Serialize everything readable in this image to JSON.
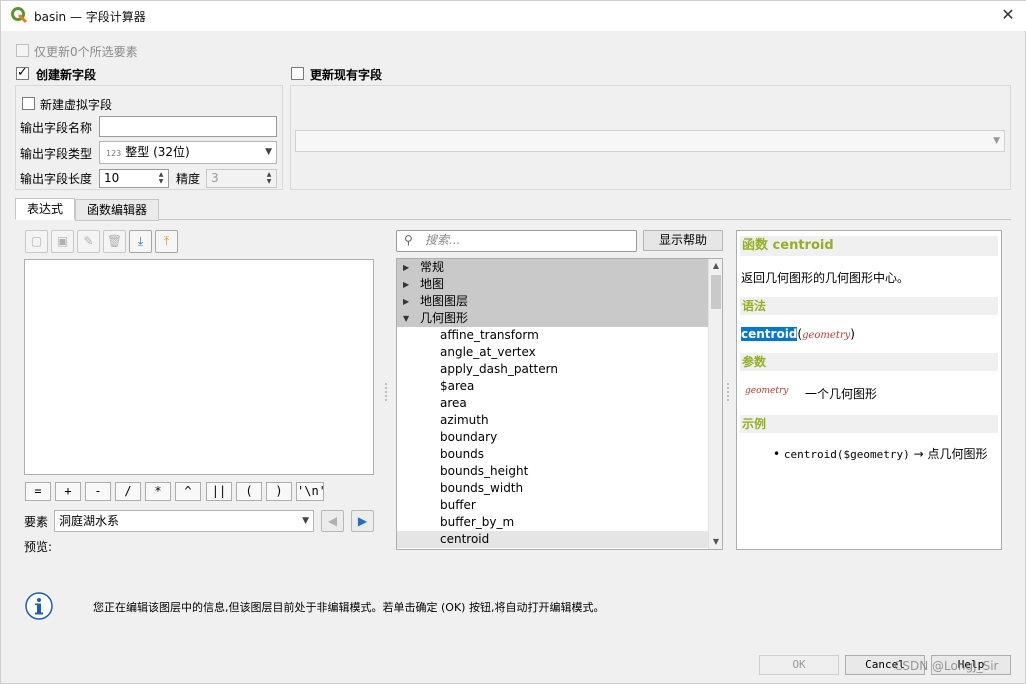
{
  "window": {
    "title": "basin — 字段计算器",
    "close_glyph": "✕",
    "app_icon": "qgis-logo-icon"
  },
  "options": {
    "only_selected_label": "仅更新0个所选要素",
    "create_new_field_label": "创建新字段",
    "create_new_field_checked": true,
    "update_existing_label": "更新现有字段",
    "update_existing_checked": false,
    "virtual_field_label": "新建虚拟字段",
    "virtual_field_checked": false
  },
  "new_field": {
    "name_label": "输出字段名称",
    "name_value": "",
    "type_label": "输出字段类型",
    "type_icon_text": "123",
    "type_value": "整型 (32位)",
    "length_label": "输出字段长度",
    "length_value": "10",
    "precision_label": "精度",
    "precision_value": "3"
  },
  "existing_field": {
    "selected_value": ""
  },
  "tabs": [
    {
      "label": "表达式",
      "active": true
    },
    {
      "label": "函数编辑器",
      "active": false
    }
  ],
  "toolbar": {
    "icons": [
      "new-file-icon",
      "save-icon",
      "edit-icon",
      "delete-icon",
      "import-icon",
      "export-icon"
    ]
  },
  "operators": [
    "=",
    "+",
    "-",
    "/",
    "*",
    "^",
    "||",
    "(",
    ")",
    "'\\n'"
  ],
  "feature": {
    "label": "要素",
    "value": "洞庭湖水系",
    "prev_glyph": "◀",
    "next_glyph": "▶"
  },
  "preview": {
    "label": "预览:",
    "value": ""
  },
  "search": {
    "placeholder": "搜索...",
    "help_button_label": "显示帮助"
  },
  "tree": {
    "groups": [
      "常规",
      "地图",
      "地图图层",
      "几何图形"
    ],
    "expanded_group": "几何图形",
    "functions": [
      "affine_transform",
      "angle_at_vertex",
      "apply_dash_pattern",
      "$area",
      "area",
      "azimuth",
      "boundary",
      "bounds",
      "bounds_height",
      "bounds_width",
      "buffer",
      "buffer_by_m",
      "centroid"
    ],
    "selected": "centroid"
  },
  "help": {
    "heading_prefix": "函数",
    "heading_name": "centroid",
    "description": "返回几何图形的几何图形中心。",
    "syntax_title": "语法",
    "syntax_func": "centroid",
    "syntax_open": "(",
    "syntax_arg": "geometry",
    "syntax_close": ")",
    "args_title": "参数",
    "arg_name": "geometry",
    "arg_desc": "一个几何图形",
    "examples_title": "示例",
    "example_code": "centroid($geometry)",
    "example_result": "→ 点几何图形"
  },
  "info": {
    "icon": "info-icon",
    "message": "您正在编辑该图层中的信息,但该图层目前处于非编辑模式。若单击确定 (OK) 按钮,将自动打开编辑模式。"
  },
  "footer": {
    "ok_label": "OK",
    "cancel_label": "Cancel",
    "help_label": "Help",
    "watermark": "CSDN @LongJ_Sir"
  },
  "colors": {
    "help_heading": "#93b023",
    "selection_blue": "#0078d7",
    "arg_red": "#c0392b",
    "info_blue": "#1a5fb4"
  }
}
